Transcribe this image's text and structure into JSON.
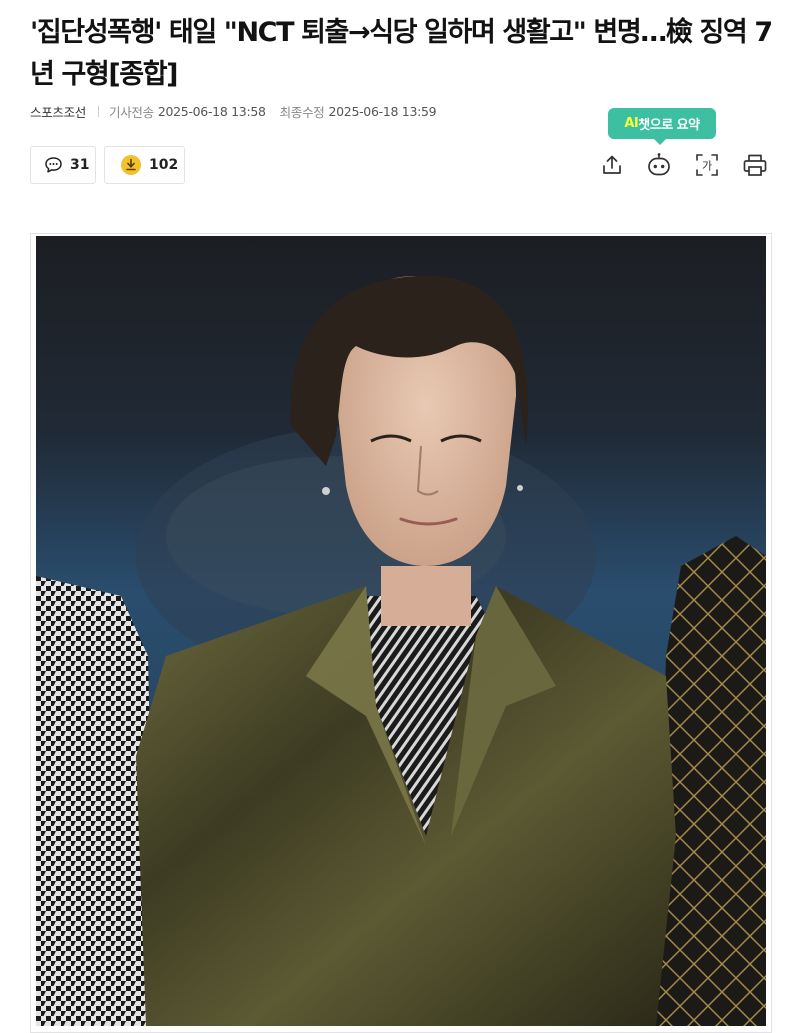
{
  "article": {
    "headline": "'집단성폭행' 태일 \"NCT 퇴출→식당 일하며 생활고\" 변명…檢 징역 7년 구형[종합]",
    "press": "스포츠조선",
    "sent_label": "기사전송",
    "sent_time": "2025-06-18 13:58",
    "modified_label": "최종수정",
    "modified_time": "2025-06-18 13:59"
  },
  "actions": {
    "comment_count": "31",
    "like_count": "102",
    "like_badge": "⭢",
    "ai_prefix": "AI",
    "ai_tooltip_rest": "챗으로 요약",
    "font_label": "가"
  },
  "colors": {
    "accent": "#3cc0a1",
    "ai_highlight": "#f6ff3a",
    "reaction_gold": "#f2c12e"
  },
  "icons": [
    "comment-icon",
    "reaction-icon",
    "share-icon",
    "ai-bot-icon",
    "font-size-icon",
    "print-icon"
  ]
}
